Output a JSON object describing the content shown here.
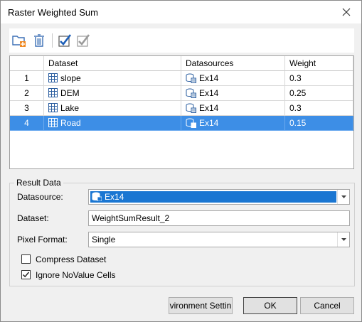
{
  "window": {
    "title": "Raster Weighted Sum"
  },
  "toolbar": {
    "icons": [
      "folder-add-icon",
      "delete-icon",
      "select-all-icon",
      "invert-select-icon"
    ]
  },
  "grid": {
    "columns": [
      "",
      "Dataset",
      "Datasources",
      "Weight"
    ],
    "rows": [
      {
        "index": "1",
        "dataset": "slope",
        "datasource": "Ex14",
        "weight": "0.3",
        "selected": false
      },
      {
        "index": "2",
        "dataset": "DEM",
        "datasource": "Ex14",
        "weight": "0.25",
        "selected": false
      },
      {
        "index": "3",
        "dataset": "Lake",
        "datasource": "Ex14",
        "weight": "0.3",
        "selected": false
      },
      {
        "index": "4",
        "dataset": "Road",
        "datasource": "Ex14",
        "weight": "0.15",
        "selected": true
      }
    ]
  },
  "result": {
    "title": "Result Data",
    "datasource_label": "Datasource:",
    "datasource_value": "Ex14",
    "dataset_label": "Dataset:",
    "dataset_value": "WeightSumResult_2",
    "pixel_format_label": "Pixel Format:",
    "pixel_format_value": "Single",
    "compress_label": "Compress Dataset",
    "compress_checked": false,
    "ignore_label": "Ignore NoValue Cells",
    "ignore_checked": true
  },
  "buttons": {
    "env": "vironment Settin",
    "ok": "OK",
    "cancel": "Cancel"
  },
  "colors": {
    "selection": "#3d8ee6",
    "accent": "#1a76d2"
  }
}
